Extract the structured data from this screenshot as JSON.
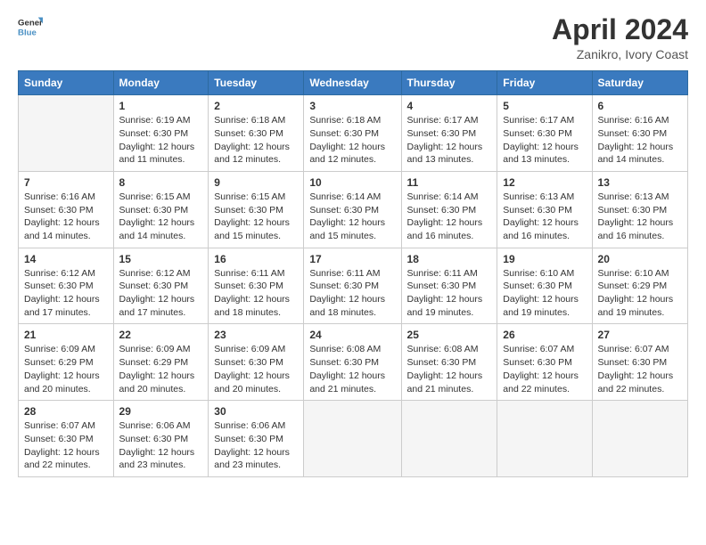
{
  "header": {
    "logo_line1": "General",
    "logo_line2": "Blue",
    "title": "April 2024",
    "subtitle": "Zanikro, Ivory Coast"
  },
  "weekdays": [
    "Sunday",
    "Monday",
    "Tuesday",
    "Wednesday",
    "Thursday",
    "Friday",
    "Saturday"
  ],
  "weeks": [
    [
      {
        "day": "",
        "detail": ""
      },
      {
        "day": "1",
        "detail": "Sunrise: 6:19 AM\nSunset: 6:30 PM\nDaylight: 12 hours\nand 11 minutes."
      },
      {
        "day": "2",
        "detail": "Sunrise: 6:18 AM\nSunset: 6:30 PM\nDaylight: 12 hours\nand 12 minutes."
      },
      {
        "day": "3",
        "detail": "Sunrise: 6:18 AM\nSunset: 6:30 PM\nDaylight: 12 hours\nand 12 minutes."
      },
      {
        "day": "4",
        "detail": "Sunrise: 6:17 AM\nSunset: 6:30 PM\nDaylight: 12 hours\nand 13 minutes."
      },
      {
        "day": "5",
        "detail": "Sunrise: 6:17 AM\nSunset: 6:30 PM\nDaylight: 12 hours\nand 13 minutes."
      },
      {
        "day": "6",
        "detail": "Sunrise: 6:16 AM\nSunset: 6:30 PM\nDaylight: 12 hours\nand 14 minutes."
      }
    ],
    [
      {
        "day": "7",
        "detail": "Sunrise: 6:16 AM\nSunset: 6:30 PM\nDaylight: 12 hours\nand 14 minutes."
      },
      {
        "day": "8",
        "detail": "Sunrise: 6:15 AM\nSunset: 6:30 PM\nDaylight: 12 hours\nand 14 minutes."
      },
      {
        "day": "9",
        "detail": "Sunrise: 6:15 AM\nSunset: 6:30 PM\nDaylight: 12 hours\nand 15 minutes."
      },
      {
        "day": "10",
        "detail": "Sunrise: 6:14 AM\nSunset: 6:30 PM\nDaylight: 12 hours\nand 15 minutes."
      },
      {
        "day": "11",
        "detail": "Sunrise: 6:14 AM\nSunset: 6:30 PM\nDaylight: 12 hours\nand 16 minutes."
      },
      {
        "day": "12",
        "detail": "Sunrise: 6:13 AM\nSunset: 6:30 PM\nDaylight: 12 hours\nand 16 minutes."
      },
      {
        "day": "13",
        "detail": "Sunrise: 6:13 AM\nSunset: 6:30 PM\nDaylight: 12 hours\nand 16 minutes."
      }
    ],
    [
      {
        "day": "14",
        "detail": "Sunrise: 6:12 AM\nSunset: 6:30 PM\nDaylight: 12 hours\nand 17 minutes."
      },
      {
        "day": "15",
        "detail": "Sunrise: 6:12 AM\nSunset: 6:30 PM\nDaylight: 12 hours\nand 17 minutes."
      },
      {
        "day": "16",
        "detail": "Sunrise: 6:11 AM\nSunset: 6:30 PM\nDaylight: 12 hours\nand 18 minutes."
      },
      {
        "day": "17",
        "detail": "Sunrise: 6:11 AM\nSunset: 6:30 PM\nDaylight: 12 hours\nand 18 minutes."
      },
      {
        "day": "18",
        "detail": "Sunrise: 6:11 AM\nSunset: 6:30 PM\nDaylight: 12 hours\nand 19 minutes."
      },
      {
        "day": "19",
        "detail": "Sunrise: 6:10 AM\nSunset: 6:30 PM\nDaylight: 12 hours\nand 19 minutes."
      },
      {
        "day": "20",
        "detail": "Sunrise: 6:10 AM\nSunset: 6:29 PM\nDaylight: 12 hours\nand 19 minutes."
      }
    ],
    [
      {
        "day": "21",
        "detail": "Sunrise: 6:09 AM\nSunset: 6:29 PM\nDaylight: 12 hours\nand 20 minutes."
      },
      {
        "day": "22",
        "detail": "Sunrise: 6:09 AM\nSunset: 6:29 PM\nDaylight: 12 hours\nand 20 minutes."
      },
      {
        "day": "23",
        "detail": "Sunrise: 6:09 AM\nSunset: 6:30 PM\nDaylight: 12 hours\nand 20 minutes."
      },
      {
        "day": "24",
        "detail": "Sunrise: 6:08 AM\nSunset: 6:30 PM\nDaylight: 12 hours\nand 21 minutes."
      },
      {
        "day": "25",
        "detail": "Sunrise: 6:08 AM\nSunset: 6:30 PM\nDaylight: 12 hours\nand 21 minutes."
      },
      {
        "day": "26",
        "detail": "Sunrise: 6:07 AM\nSunset: 6:30 PM\nDaylight: 12 hours\nand 22 minutes."
      },
      {
        "day": "27",
        "detail": "Sunrise: 6:07 AM\nSunset: 6:30 PM\nDaylight: 12 hours\nand 22 minutes."
      }
    ],
    [
      {
        "day": "28",
        "detail": "Sunrise: 6:07 AM\nSunset: 6:30 PM\nDaylight: 12 hours\nand 22 minutes."
      },
      {
        "day": "29",
        "detail": "Sunrise: 6:06 AM\nSunset: 6:30 PM\nDaylight: 12 hours\nand 23 minutes."
      },
      {
        "day": "30",
        "detail": "Sunrise: 6:06 AM\nSunset: 6:30 PM\nDaylight: 12 hours\nand 23 minutes."
      },
      {
        "day": "",
        "detail": ""
      },
      {
        "day": "",
        "detail": ""
      },
      {
        "day": "",
        "detail": ""
      },
      {
        "day": "",
        "detail": ""
      }
    ]
  ]
}
